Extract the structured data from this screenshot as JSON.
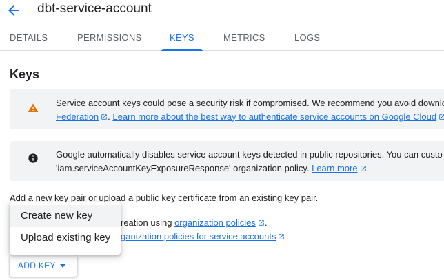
{
  "header": {
    "back_icon": "arrow-back-icon",
    "title": "dbt-service-account"
  },
  "tabs": [
    {
      "label": "DETAILS",
      "active": false
    },
    {
      "label": "PERMISSIONS",
      "active": false
    },
    {
      "label": "KEYS",
      "active": true
    },
    {
      "label": "METRICS",
      "active": false
    },
    {
      "label": "LOGS",
      "active": false
    }
  ],
  "main": {
    "heading": "Keys",
    "warning": {
      "icon": "warning-icon",
      "line1": "Service account keys could pose a security risk if compromised. We recommend you avoid downlo",
      "link_federation": "Federation",
      "link_learn_more": "Learn more about the best way to authenticate service accounts on Google Cloud"
    },
    "info": {
      "icon": "info-icon",
      "line1": "Google automatically disables service account keys detected in public repositories. You can custo",
      "line2": "'iam.serviceAccountKeyExposureResponse' organization policy.",
      "link_learn_more": "Learn more"
    },
    "intro_text": "Add a new key pair or upload a public key certificate from an existing key pair.",
    "policy_line1_text": "reation using",
    "policy_link1": "organization policies",
    "policy_link2": "ganization policies for service accounts",
    "add_key_label": "ADD KEY"
  },
  "menu": {
    "items": [
      "Create new key",
      "Upload existing key"
    ]
  },
  "colors": {
    "accent": "#1a73e8",
    "warning": "#e37400",
    "banner_bg": "#f1f3f4",
    "text": "#202124"
  }
}
